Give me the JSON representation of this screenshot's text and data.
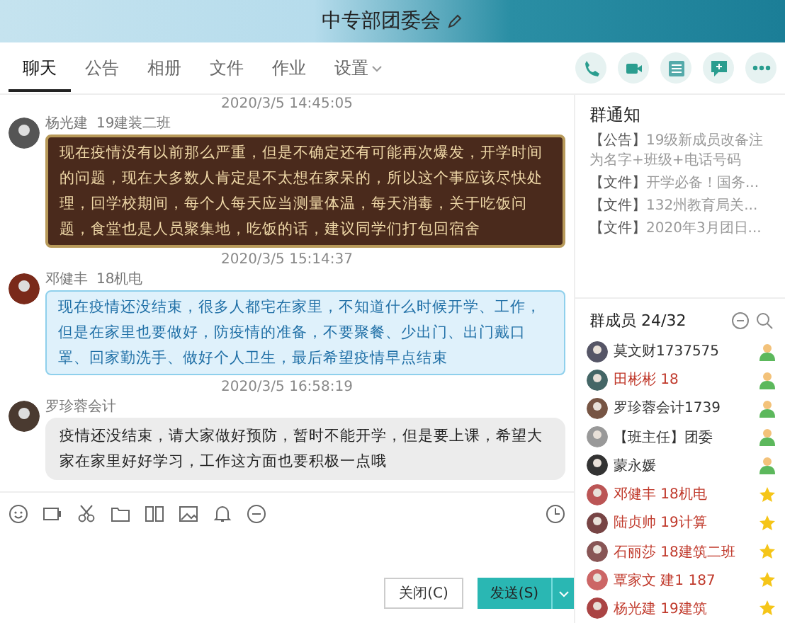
{
  "window": {
    "title": "中专部团委会"
  },
  "tabs": [
    {
      "label": "聊天",
      "selected": true
    },
    {
      "label": "公告",
      "selected": false
    },
    {
      "label": "相册",
      "selected": false
    },
    {
      "label": "文件",
      "selected": false
    },
    {
      "label": "作业",
      "selected": false
    },
    {
      "label": "设置",
      "selected": false
    }
  ],
  "messages": [
    {
      "time": "2020/3/5 14:45:05",
      "sender": "杨光建",
      "tag": "19建装二班",
      "kind": "dark",
      "text": "现在疫情没有以前那么严重，但是不确定还有可能再次爆发，开学时间的问题，现在大多数人肯定是不太想在家呆的，所以这个事应该尽快处理，回学校期间，每个人每天应当测量体温，每天消毒，关于吃饭问题，食堂也是人员聚集地，吃饭的话，建议同学们打包回宿舍"
    },
    {
      "time": "2020/3/5 15:14:37",
      "sender": "邓健丰",
      "tag": "18机电",
      "kind": "blue",
      "text": "现在疫情还没结束，很多人都宅在家里，不知道什么时候开学、工作，但是在家里也要做好，防疫情的准备，不要聚餐、少出门、出门戴口罩、回家勤洗手、做好个人卫生，最后希望疫情早点结束"
    },
    {
      "time": "2020/3/5 16:58:19",
      "sender": "罗珍蓉会计",
      "kind": "gray",
      "text": "疫情还没结束，请大家做好预防，暂时不能开学，但是要上课，希望大家在家里好好学习，工作这方面也要积极一点哦"
    }
  ],
  "buttons": {
    "close": "关闭(C)",
    "send": "发送(S)"
  },
  "notice": {
    "title": "群通知",
    "items": [
      {
        "tag": "【公告】",
        "text": "19级新成员改备注为名字+班级+电话号码"
      },
      {
        "tag": "【文件】",
        "text": "开学必备！国务..."
      },
      {
        "tag": "【文件】",
        "text": "132州教育局关..."
      },
      {
        "tag": "【文件】",
        "text": "2020年3月团日..."
      }
    ]
  },
  "members": {
    "title": "群成员 24/32",
    "items": [
      {
        "name": "莫文财1737575",
        "color": "#333333",
        "kind": "admin"
      },
      {
        "name": "田彬彬  18",
        "color": "#c0392b",
        "kind": "admin"
      },
      {
        "name": "罗珍蓉会计1739",
        "color": "#333333",
        "kind": "admin"
      },
      {
        "name": "【班主任】团委",
        "color": "#333333",
        "kind": "admin"
      },
      {
        "name": "蒙永媛",
        "color": "#333333",
        "kind": "admin"
      },
      {
        "name": "邓健丰  18机电",
        "color": "#c0392b",
        "kind": "star"
      },
      {
        "name": "陆贞帅  19计算",
        "color": "#c0392b",
        "kind": "star"
      },
      {
        "name": "石丽莎  18建筑二班",
        "color": "#c0392b",
        "kind": "star"
      },
      {
        "name": "覃家文 建1  187",
        "color": "#c0392b",
        "kind": "star"
      },
      {
        "name": "杨光建  19建筑",
        "color": "#c0392b",
        "kind": "star"
      }
    ]
  }
}
